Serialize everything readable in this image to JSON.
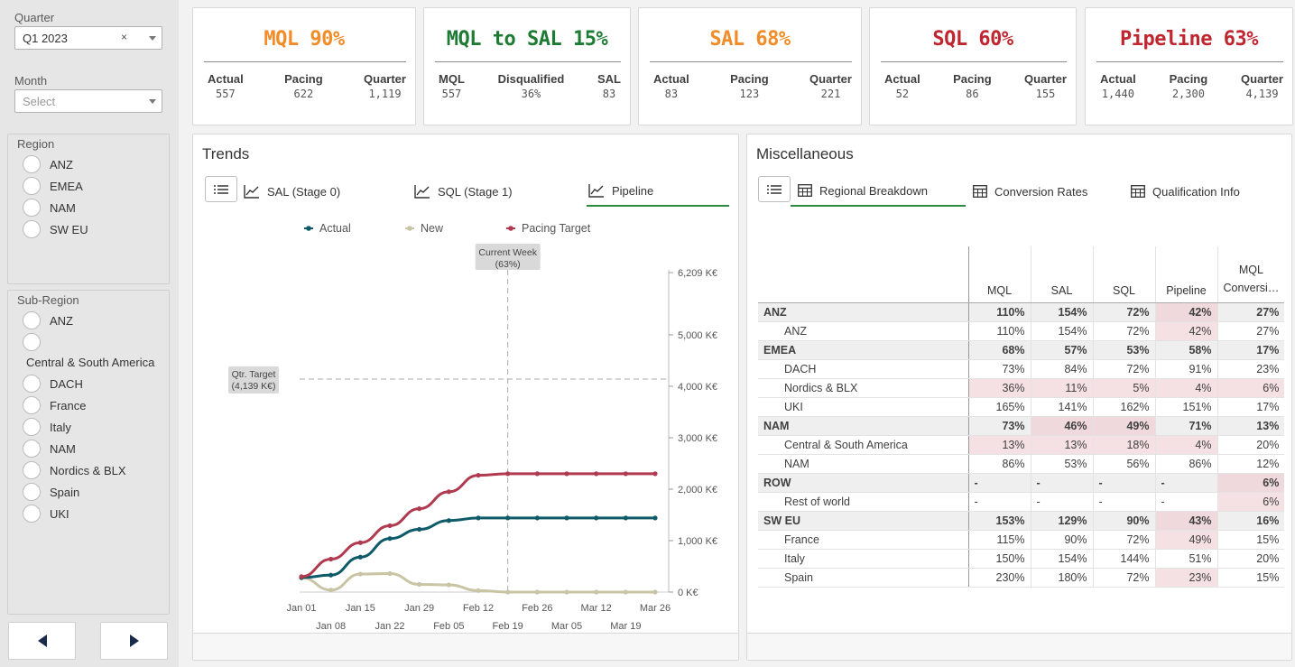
{
  "filters": {
    "quarter": {
      "label": "Quarter",
      "value": "Q1 2023",
      "clear": "×"
    },
    "month": {
      "label": "Month",
      "placeholder": "Select"
    },
    "region": {
      "title": "Region",
      "items": [
        "ANZ",
        "EMEA",
        "NAM",
        "SW EU"
      ]
    },
    "subregion": {
      "title": "Sub-Region",
      "items": [
        "ANZ",
        "",
        "DACH",
        "France",
        "Italy",
        "NAM",
        "Nordics & BLX",
        "Spain",
        "UKI"
      ],
      "wrapped_label": "Central & South America"
    }
  },
  "kpis": [
    {
      "title": "MQL 90%",
      "color": "#f28c28",
      "cols": [
        {
          "h": "Actual",
          "v": "557"
        },
        {
          "h": "Pacing",
          "v": "622"
        },
        {
          "h": "Quarter",
          "v": "1,119"
        }
      ]
    },
    {
      "title": "MQL to SAL 15%",
      "color": "#1e7b34",
      "cols": [
        {
          "h": "MQL",
          "v": "557"
        },
        {
          "h": "Disqualified",
          "v": "36%"
        },
        {
          "h": "SAL",
          "v": "83"
        }
      ]
    },
    {
      "title": "SAL 68%",
      "color": "#f28c28",
      "cols": [
        {
          "h": "Actual",
          "v": "83"
        },
        {
          "h": "Pacing",
          "v": "123"
        },
        {
          "h": "Quarter",
          "v": "221"
        }
      ]
    },
    {
      "title": "SQL 60%",
      "color": "#c0262f",
      "cols": [
        {
          "h": "Actual",
          "v": "52"
        },
        {
          "h": "Pacing",
          "v": "86"
        },
        {
          "h": "Quarter",
          "v": "155"
        }
      ]
    },
    {
      "title": "Pipeline 63%",
      "color": "#c0262f",
      "cols": [
        {
          "h": "Actual",
          "v": "1,440"
        },
        {
          "h": "Pacing",
          "v": "2,300"
        },
        {
          "h": "Quarter",
          "v": "4,139"
        }
      ]
    }
  ],
  "trends": {
    "title": "Trends",
    "tabs": [
      "SAL (Stage 0)",
      "SQL (Stage 1)",
      "Pipeline"
    ],
    "active_tab": "Pipeline"
  },
  "chart_data": {
    "type": "line",
    "x_labels_top": [
      "Jan 01",
      "Jan 15",
      "Jan 29",
      "Feb 12",
      "Feb 26",
      "Mar 12",
      "Mar 26"
    ],
    "x_labels_bottom": [
      "Jan 08",
      "Jan 22",
      "Feb 05",
      "Feb 19",
      "Mar 05",
      "Mar 19"
    ],
    "y_ticks": [
      "0 K€",
      "1,000 K€",
      "2,000 K€",
      "3,000 K€",
      "4,000 K€",
      "5,000 K€",
      "6,209 K€"
    ],
    "y_tick_values": [
      0,
      1000,
      2000,
      3000,
      4000,
      5000,
      6209
    ],
    "ylim": [
      0,
      6209
    ],
    "legend": [
      "Actual",
      "New",
      "Pacing Target"
    ],
    "series": [
      {
        "name": "Actual",
        "color": "#0e5a68",
        "values": [
          280,
          330,
          680,
          1040,
          1220,
          1390,
          1440,
          1440,
          1440,
          1440,
          1440,
          1440,
          1440
        ]
      },
      {
        "name": "New",
        "color": "#c8c4a4",
        "values": [
          280,
          40,
          350,
          360,
          150,
          140,
          30,
          0,
          0,
          0,
          0,
          0,
          0
        ]
      },
      {
        "name": "Pacing Target",
        "color": "#b03a4f",
        "values": [
          300,
          640,
          960,
          1290,
          1620,
          1950,
          2270,
          2300,
          2300,
          2300,
          2300,
          2300,
          2300
        ]
      }
    ],
    "annotations": {
      "current_week": "Current Week",
      "current_week_pct": "(63%)",
      "current_week_index": 7,
      "target": "Qtr. Target",
      "target_value": "(4,139 K€)",
      "target_y": 4139
    }
  },
  "misc": {
    "title": "Miscellaneous",
    "tabs": [
      "Regional Breakdown",
      "Conversion Rates",
      "Qualification Info"
    ],
    "active_tab": "Regional Breakdown",
    "table": {
      "headers": [
        "MQL",
        "SAL",
        "SQL",
        "Pipeline",
        "MQL",
        "Conversi…"
      ],
      "rows": [
        {
          "name": "ANZ",
          "group": true,
          "vals": [
            "110%",
            "154%",
            "72%",
            "42%",
            "27%"
          ],
          "hl": [
            false,
            false,
            false,
            true,
            false
          ]
        },
        {
          "name": "ANZ",
          "group": false,
          "vals": [
            "110%",
            "154%",
            "72%",
            "42%",
            "27%"
          ],
          "hl": [
            false,
            false,
            false,
            true,
            false
          ]
        },
        {
          "name": "EMEA",
          "group": true,
          "vals": [
            "68%",
            "57%",
            "53%",
            "58%",
            "17%"
          ],
          "hl": [
            false,
            false,
            false,
            false,
            false
          ]
        },
        {
          "name": "DACH",
          "group": false,
          "vals": [
            "73%",
            "84%",
            "72%",
            "91%",
            "23%"
          ],
          "hl": [
            false,
            false,
            false,
            false,
            false
          ]
        },
        {
          "name": "Nordics & BLX",
          "group": false,
          "vals": [
            "36%",
            "11%",
            "5%",
            "4%",
            "6%"
          ],
          "hl": [
            true,
            true,
            true,
            true,
            true
          ]
        },
        {
          "name": "UKI",
          "group": false,
          "vals": [
            "165%",
            "141%",
            "162%",
            "151%",
            "17%"
          ],
          "hl": [
            false,
            false,
            false,
            false,
            false
          ]
        },
        {
          "name": "NAM",
          "group": true,
          "vals": [
            "73%",
            "46%",
            "49%",
            "71%",
            "13%"
          ],
          "hl": [
            false,
            true,
            true,
            false,
            false
          ]
        },
        {
          "name": "Central & South America",
          "group": false,
          "vals": [
            "13%",
            "13%",
            "18%",
            "4%",
            "20%"
          ],
          "hl": [
            true,
            true,
            true,
            true,
            false
          ]
        },
        {
          "name": "NAM",
          "group": false,
          "vals": [
            "86%",
            "53%",
            "56%",
            "86%",
            "12%"
          ],
          "hl": [
            false,
            false,
            false,
            false,
            false
          ]
        },
        {
          "name": "ROW",
          "group": true,
          "vals": [
            "-",
            "-",
            "-",
            "-",
            "6%"
          ],
          "hl": [
            false,
            false,
            false,
            false,
            true
          ]
        },
        {
          "name": "Rest of world",
          "group": false,
          "vals": [
            "-",
            "-",
            "-",
            "-",
            "6%"
          ],
          "hl": [
            false,
            false,
            false,
            false,
            true
          ]
        },
        {
          "name": "SW EU",
          "group": true,
          "vals": [
            "153%",
            "129%",
            "90%",
            "43%",
            "16%"
          ],
          "hl": [
            false,
            false,
            false,
            true,
            false
          ]
        },
        {
          "name": "France",
          "group": false,
          "vals": [
            "115%",
            "90%",
            "72%",
            "49%",
            "15%"
          ],
          "hl": [
            false,
            false,
            false,
            true,
            false
          ]
        },
        {
          "name": "Italy",
          "group": false,
          "vals": [
            "150%",
            "154%",
            "144%",
            "51%",
            "20%"
          ],
          "hl": [
            false,
            false,
            false,
            false,
            false
          ]
        },
        {
          "name": "Spain",
          "group": false,
          "vals": [
            "230%",
            "180%",
            "72%",
            "23%",
            "15%"
          ],
          "hl": [
            false,
            false,
            false,
            true,
            false
          ]
        }
      ]
    }
  }
}
